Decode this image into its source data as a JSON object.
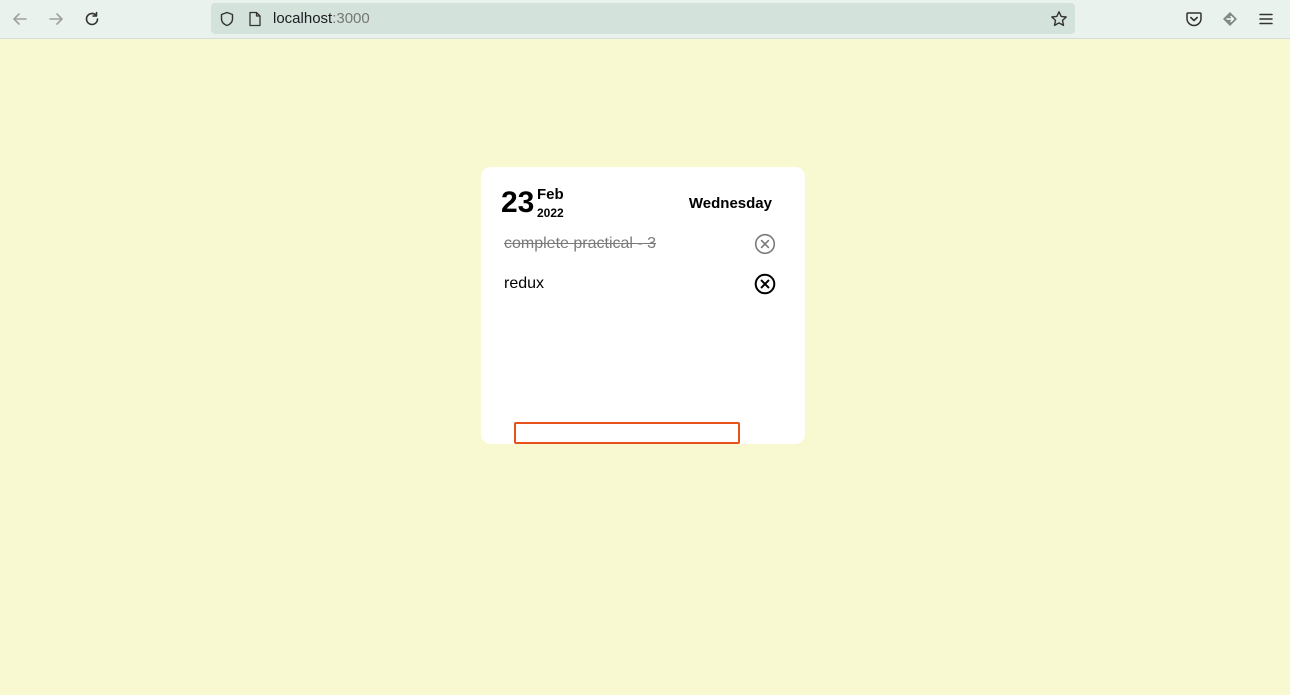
{
  "browser": {
    "url_host": "localhost",
    "url_port": ":3000",
    "icons": {
      "back": "arrow-left-icon",
      "forward": "arrow-right-icon",
      "reload": "reload-icon",
      "shield": "shield-icon",
      "page": "page-icon",
      "bookmark": "star-icon",
      "pocket": "pocket-icon",
      "extensions": "extension-icon",
      "menu": "hamburger-menu-icon"
    }
  },
  "card": {
    "day": "23",
    "month": "Feb",
    "year": "2022",
    "weekday": "Wednesday"
  },
  "todos": [
    {
      "text": "complete practical - 3",
      "completed": true
    },
    {
      "text": "redux",
      "completed": false
    }
  ],
  "new_todo": {
    "value": "",
    "placeholder": ""
  },
  "colors": {
    "background": "#f9f9d1",
    "card": "#ffffff",
    "input_border": "#e8511c",
    "completed_text": "#7a7a7a"
  }
}
